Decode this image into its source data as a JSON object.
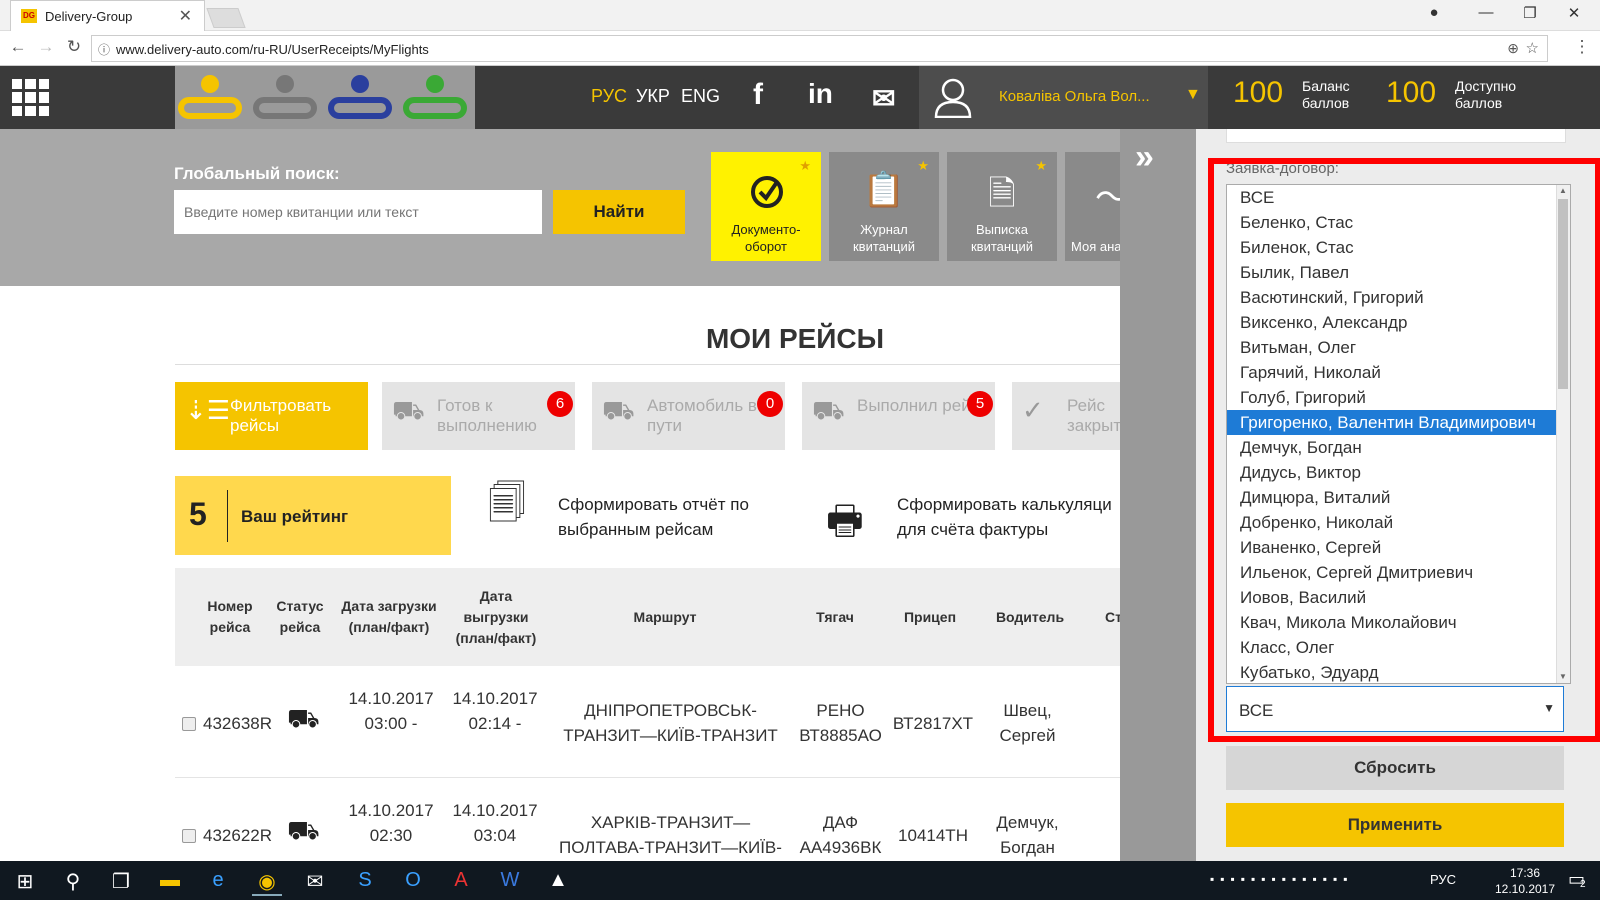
{
  "browser": {
    "tab_title": "Delivery-Group",
    "tab_icon": "DG",
    "url": "www.delivery-auto.com/ru-RU/UserReceipts/MyFlights"
  },
  "header": {
    "langs": [
      "РУС",
      "УКР",
      "ENG"
    ],
    "user_name": "Коваліва Ольга Вол...",
    "balance_value": "100",
    "balance_label": "Баланс баллов",
    "available_value": "100",
    "available_label": "Доступно баллов"
  },
  "search": {
    "label": "Глобальный поиск:",
    "placeholder": "Введите номер квитанции или текст",
    "button": "Найти"
  },
  "quick_tiles": [
    {
      "label": "Документо-оборот"
    },
    {
      "label": "Журнал квитанций"
    },
    {
      "label": "Выписка квитанций"
    },
    {
      "label": "Моя ана"
    }
  ],
  "page_title": "МОИ РЕЙСЫ",
  "filters": [
    {
      "label": "Фильтровать рейсы",
      "badge": ""
    },
    {
      "label": "Готов к выполнению",
      "badge": "6"
    },
    {
      "label": "Автомобиль в пути",
      "badge": "0"
    },
    {
      "label": "Выполнил рейс",
      "badge": "5"
    },
    {
      "label": "Рейс закрыт",
      "badge": ""
    }
  ],
  "rating": {
    "value": "5",
    "label": "Ваш рейтинг"
  },
  "actions": {
    "report": "Сформировать отчёт по выбранным рейсам",
    "calc": "Сформировать калькуляци для счёта фактуры"
  },
  "table": {
    "headers": [
      "Номер рейса",
      "Статус рейса",
      "Дата загрузки (план/факт)",
      "Дата выгрузки (план/факт)",
      "Маршрут",
      "Тягач",
      "Прицеп",
      "Водитель",
      "Ст"
    ],
    "rows": [
      {
        "id": "432638R",
        "load": "14.10.2017 03:00 -",
        "unload": "14.10.2017 02:14 -",
        "route": "ДНІПРОПЕТРОВСЬК-ТРАНЗИТ—КИЇВ-ТРАНЗИТ",
        "truck": "РЕНО ВТ8885АО",
        "trailer": "ВТ2817ХТ",
        "driver": "Швец, Сергей"
      },
      {
        "id": "432622R",
        "load": "14.10.2017 02:30",
        "unload": "14.10.2017 03:04",
        "route": "ХАРКІВ-ТРАНЗИТ—ПОЛТАВА-ТРАНЗИТ—КИЇВ-ТРАНЗИТ",
        "truck": "ДАФ АА4936ВК",
        "trailer": "10414ТН",
        "driver": "Демчук, Богдан"
      }
    ]
  },
  "side_panel": {
    "contract_label": "Заявка-договор:",
    "contracts": [
      "ВСЕ",
      "Беленко, Стас",
      "Биленок, Стас",
      "Былик, Павел",
      "Васютинский, Григорий",
      "Виксенко, Александр",
      "Витьман, Олег",
      "Гарячий, Николай",
      "Голуб, Григорий",
      "Григоренко, Валентин Владимирович",
      "Демчук, Богдан",
      "Дидусь, Виктор",
      "Димцюра, Виталий",
      "Добренко, Николай",
      "Иваненко, Сергей",
      "Ильенок, Сергей Дмитриевич",
      "Иовов, Василий",
      "Квач, Микола Миколайович",
      "Класс, Олег",
      "Кубатько, Эдуард"
    ],
    "selected_index": 9,
    "select_value": "ВСЕ",
    "reset": "Сбросить",
    "apply": "Применить"
  },
  "taskbar": {
    "lang": "РУС",
    "time": "17:36",
    "date": "12.10.2017",
    "notif": "2"
  },
  "colors": {
    "accent": "#f5c400",
    "highlight_border": "#ff0000",
    "selection": "#1e7bd6"
  }
}
